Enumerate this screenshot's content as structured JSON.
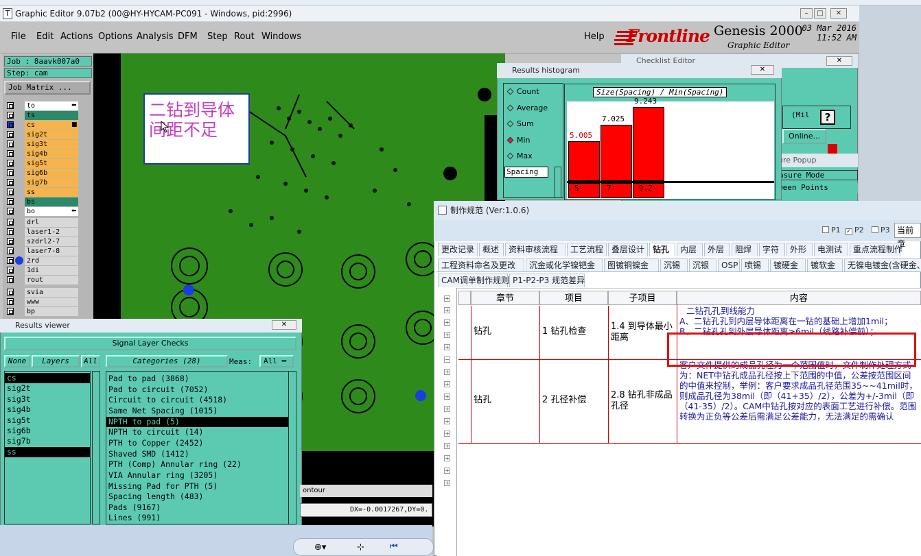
{
  "window": {
    "title": "Graphic Editor 9.07b2 (00@HY-HYCAM-PC091 - Windows, pid:2996)"
  },
  "menubar": {
    "items": [
      "File",
      "Edit",
      "Actions",
      "Options",
      "Analysis",
      "DFM",
      "Step",
      "Rout",
      "Windows"
    ],
    "help": "Help"
  },
  "brand": {
    "logo": "Frontline",
    "product": "Genesis 2000",
    "subtitle": "Graphic Editor",
    "date": "03 Mar 2016",
    "time": "11:52 AM"
  },
  "job": {
    "job_line": "Job : 8aavk007a0",
    "step_line": "Step: cam",
    "matrix_button": "Job Matrix ..."
  },
  "layers": [
    {
      "name": "to",
      "color": "#ffffff",
      "mark": "⬅"
    },
    {
      "name": "ts",
      "color": "#2a8a6a"
    },
    {
      "name": "cs",
      "color": "#f7b44a",
      "mark": "■"
    },
    {
      "name": "sig2t",
      "color": "#f7b44a"
    },
    {
      "name": "sig3t",
      "color": "#f7b44a"
    },
    {
      "name": "sig4b",
      "color": "#f7b44a"
    },
    {
      "name": "sig5t",
      "color": "#f7b44a"
    },
    {
      "name": "sig6b",
      "color": "#f7b44a"
    },
    {
      "name": "sig7b",
      "color": "#f7b44a"
    },
    {
      "name": "ss",
      "color": "#f7b44a"
    },
    {
      "name": "bs",
      "color": "#2a8a6a"
    },
    {
      "name": "bo",
      "color": "#ffffff",
      "mark": "⬅"
    },
    {
      "name": "drl",
      "color": "#d8d8d8"
    },
    {
      "name": "laser1-2",
      "color": "#d8d8d8"
    },
    {
      "name": "szdrl2-7",
      "color": "#d8d8d8"
    },
    {
      "name": "laser7-8",
      "color": "#d8d8d8"
    },
    {
      "name": "2rd",
      "color": "#d8d8d8"
    },
    {
      "name": "1di",
      "color": "#d8d8d8"
    },
    {
      "name": "rout",
      "color": "#d8d8d8"
    },
    {
      "name": "svia",
      "color": "#d8d8d8"
    },
    {
      "name": "www",
      "color": "#d8d8d8"
    },
    {
      "name": "bp",
      "color": "#d8d8d8"
    }
  ],
  "annotation_note": "二钻到导体间距不足",
  "histogram": {
    "title": "Results histogram",
    "options": [
      "Count",
      "Average",
      "Sum",
      "Min",
      "Max"
    ],
    "selected_option": "Min",
    "spacing_label": "Spacing",
    "chart_label": "Size(Spacing) / Min(Spacing)",
    "bars": [
      {
        "value": "5.005",
        "range": "5-"
      },
      {
        "value": "7.025",
        "range": "7-"
      },
      {
        "value": "9.243",
        "range": "9.2-"
      }
    ]
  },
  "checklist": {
    "title": "Checklist Editor",
    "mil": "(Mil",
    "help": "?",
    "online": "Online...",
    "popup": "ure Popup",
    "measure_mode": "asure Mode",
    "between": "ween Points"
  },
  "results_viewer": {
    "title": "Results viewer",
    "header": "Signal Layer Checks",
    "none_btn": "None",
    "layers_btn": "Layers",
    "all_btn": "All",
    "categories_btn": "Categories (28)",
    "meas_label": "Meas:",
    "meas_value": "All",
    "layer_items": [
      "cs",
      "sig2t",
      "sig3t",
      "sig4b",
      "sig5t",
      "sig6b",
      "sig7b",
      "ss"
    ],
    "layer_selected": [
      "cs",
      "ss"
    ],
    "categories": [
      "Pad to pad (3868)",
      "Pad to circuit (7052)",
      "Circuit to circuit (4518)",
      "Same Net Spacing (1015)",
      "NPTH to pad (5)",
      "NPTH to circuit (14)",
      "PTH to Copper (2452)",
      "Shaved SMD (1412)",
      "PTH (Comp) Annular ring (22)",
      "VIA Annular ring (3205)",
      "Missing Pad for PTH (5)",
      "Spacing length (483)",
      "Pads (9167)",
      "Lines (991)"
    ],
    "category_selected": "NPTH to pad (5)"
  },
  "status": {
    "contour": "ontour",
    "coords": "DX=-0.0017267,DY=0."
  },
  "spec": {
    "title": "制作规范 (Ver:1.0.6)",
    "checks": [
      {
        "label": "P1",
        "checked": false
      },
      {
        "label": "P2",
        "checked": true
      },
      {
        "label": "P3",
        "checked": false
      }
    ],
    "current_chapter": "当前章",
    "tabs_row1": [
      "更改记录",
      "概述",
      "资料审核流程",
      "工艺流程",
      "叠层设计",
      "钻孔",
      "内层",
      "外层",
      "阻焊",
      "字符",
      "外形",
      "电测试",
      "重点流程制作"
    ],
    "tabs_row2": [
      "工程资料命名及更改",
      "沉金或化学镍钯金",
      "图镀铜镍金",
      "沉锡",
      "沉银",
      "OSP",
      "喷锡",
      "镀硬金",
      "镀软金",
      "无镍电镀金(含硬金、软"
    ],
    "tabs_row3": [
      "CAM调单制作规则",
      "P1-P2-P3 规范差异"
    ],
    "selected_tab": "钻孔",
    "columns": [
      "章节",
      "项目",
      "子项目",
      "内容"
    ],
    "rows": [
      {
        "chapter": "钻孔",
        "item": "1 钻孔检查",
        "subitem": "1.4 到导体最小距离",
        "content": [
          "二钻孔孔到线能力",
          "A、二钻孔孔到内层导体距离在一钻的基础上增加1mil；",
          "B、二钻孔孔到外层导体距离≥6mil（线路补偿前）；"
        ]
      },
      {
        "chapter": "钻孔",
        "item": "2 孔径补偿",
        "subitem": "2.8 钻孔非成品孔径",
        "content": [
          "客户文件提供的成品孔径为一个范围值时，文件制作处理方式为：NET中钻孔成品孔径按上下范围的中值，公差按范围区间的中值来控制，举例：客户要求成品孔径范围35~~41mil时，则成品孔径为38mil（即（41+35）/2），公差为+/-3mil（即（41-35）/2）。CAM中钻孔按对应的表面工艺进行补偿。范围转换为正负等公差后需满足公差能力，无法满足的需确认"
        ]
      }
    ]
  }
}
